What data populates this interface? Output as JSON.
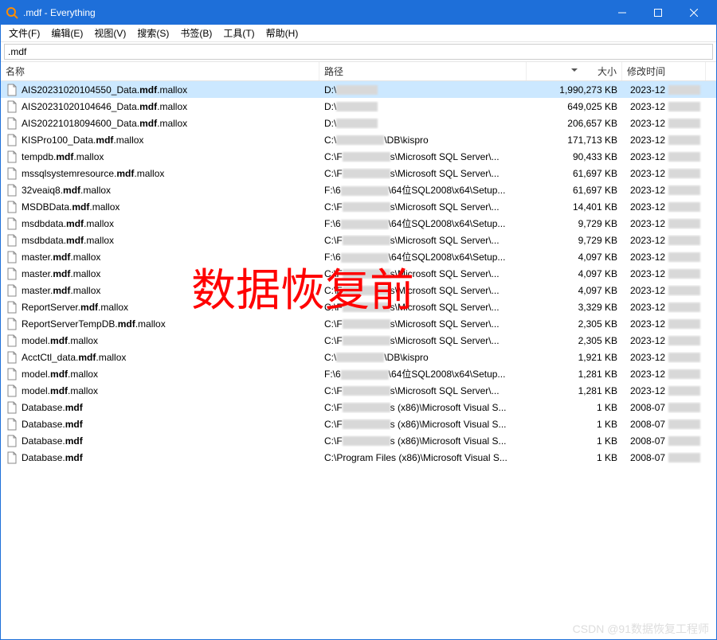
{
  "titlebar": {
    "title": ".mdf - Everything"
  },
  "menubar": {
    "file": "文件(F)",
    "edit": "编辑(E)",
    "view": "视图(V)",
    "search": "搜索(S)",
    "bookmarks": "书签(B)",
    "tools": "工具(T)",
    "help": "帮助(H)"
  },
  "search": {
    "value": ".mdf"
  },
  "columns": {
    "name": "名称",
    "path": "路径",
    "size": "大小",
    "date": "修改时间"
  },
  "overlay": "数据恢复前",
  "watermark": "CSDN @91数据恢复工程师",
  "rows": [
    {
      "selected": true,
      "name_pre": "AIS20231020104550_Data.",
      "name_bold": "mdf",
      "name_post": ".mallox",
      "path_pre": "D:\\",
      "path_censor_w": 52,
      "path_post": "",
      "size": "1,990,273 KB",
      "date": "2023-12",
      "date_censor_w": 40
    },
    {
      "name_pre": "AIS20231020104646_Data.",
      "name_bold": "mdf",
      "name_post": ".mallox",
      "path_pre": "D:\\",
      "path_censor_w": 52,
      "path_post": "",
      "size": "649,025 KB",
      "date": "2023-12",
      "date_censor_w": 40
    },
    {
      "name_pre": "AIS20221018094600_Data.",
      "name_bold": "mdf",
      "name_post": ".mallox",
      "path_pre": "D:\\",
      "path_censor_w": 52,
      "path_post": "",
      "size": "206,657 KB",
      "date": "2023-12",
      "date_censor_w": 40
    },
    {
      "name_pre": "KISPro100_Data.",
      "name_bold": "mdf",
      "name_post": ".mallox",
      "path_pre": "C:\\",
      "path_censor_w": 60,
      "path_post": "\\DB\\kispro",
      "size": "171,713 KB",
      "date": "2023-12",
      "date_censor_w": 40
    },
    {
      "name_pre": "tempdb.",
      "name_bold": "mdf",
      "name_post": ".mallox",
      "path_pre": "C:\\F",
      "path_censor_w": 60,
      "path_post": "s\\Microsoft SQL Server\\...",
      "size": "90,433 KB",
      "date": "2023-12",
      "date_censor_w": 40
    },
    {
      "name_pre": "mssqlsystemresource.",
      "name_bold": "mdf",
      "name_post": ".mallox",
      "path_pre": "C:\\F",
      "path_censor_w": 60,
      "path_post": "s\\Microsoft SQL Server\\...",
      "size": "61,697 KB",
      "date": "2023-12",
      "date_censor_w": 40
    },
    {
      "name_pre": "32veaiq8.",
      "name_bold": "mdf",
      "name_post": ".mallox",
      "path_pre": "F:\\6",
      "path_censor_w": 60,
      "path_post": "\\64位SQL2008\\x64\\Setup...",
      "size": "61,697 KB",
      "date": "2023-12",
      "date_censor_w": 40
    },
    {
      "name_pre": "MSDBData.",
      "name_bold": "mdf",
      "name_post": ".mallox",
      "path_pre": "C:\\F",
      "path_censor_w": 60,
      "path_post": "s\\Microsoft SQL Server\\...",
      "size": "14,401 KB",
      "date": "2023-12",
      "date_censor_w": 40
    },
    {
      "name_pre": "msdbdata.",
      "name_bold": "mdf",
      "name_post": ".mallox",
      "path_pre": "F:\\6",
      "path_censor_w": 60,
      "path_post": "\\64位SQL2008\\x64\\Setup...",
      "size": "9,729 KB",
      "date": "2023-12",
      "date_censor_w": 40
    },
    {
      "name_pre": "msdbdata.",
      "name_bold": "mdf",
      "name_post": ".mallox",
      "path_pre": "C:\\F",
      "path_censor_w": 60,
      "path_post": "s\\Microsoft SQL Server\\...",
      "size": "9,729 KB",
      "date": "2023-12",
      "date_censor_w": 40
    },
    {
      "name_pre": "master.",
      "name_bold": "mdf",
      "name_post": ".mallox",
      "path_pre": "F:\\6",
      "path_censor_w": 60,
      "path_post": "\\64位SQL2008\\x64\\Setup...",
      "size": "4,097 KB",
      "date": "2023-12",
      "date_censor_w": 40
    },
    {
      "name_pre": "master.",
      "name_bold": "mdf",
      "name_post": ".mallox",
      "path_pre": "C:\\F",
      "path_censor_w": 60,
      "path_post": "s\\Microsoft SQL Server\\...",
      "size": "4,097 KB",
      "date": "2023-12",
      "date_censor_w": 40
    },
    {
      "name_pre": "master.",
      "name_bold": "mdf",
      "name_post": ".mallox",
      "path_pre": "C:\\F",
      "path_censor_w": 60,
      "path_post": "s\\Microsoft SQL Server\\...",
      "size": "4,097 KB",
      "date": "2023-12",
      "date_censor_w": 40
    },
    {
      "name_pre": "ReportServer.",
      "name_bold": "mdf",
      "name_post": ".mallox",
      "path_pre": "C:\\F",
      "path_censor_w": 60,
      "path_post": "s\\Microsoft SQL Server\\...",
      "size": "3,329 KB",
      "date": "2023-12",
      "date_censor_w": 40
    },
    {
      "name_pre": "ReportServerTempDB.",
      "name_bold": "mdf",
      "name_post": ".mallox",
      "path_pre": "C:\\F",
      "path_censor_w": 60,
      "path_post": "s\\Microsoft SQL Server\\...",
      "size": "2,305 KB",
      "date": "2023-12",
      "date_censor_w": 40
    },
    {
      "name_pre": "model.",
      "name_bold": "mdf",
      "name_post": ".mallox",
      "path_pre": "C:\\F",
      "path_censor_w": 60,
      "path_post": "s\\Microsoft SQL Server\\...",
      "size": "2,305 KB",
      "date": "2023-12",
      "date_censor_w": 40
    },
    {
      "name_pre": "AcctCtl_data.",
      "name_bold": "mdf",
      "name_post": ".mallox",
      "path_pre": "C:\\",
      "path_censor_w": 60,
      "path_post": "\\DB\\kispro",
      "size": "1,921 KB",
      "date": "2023-12",
      "date_censor_w": 40
    },
    {
      "name_pre": "model.",
      "name_bold": "mdf",
      "name_post": ".mallox",
      "path_pre": "F:\\6",
      "path_censor_w": 60,
      "path_post": "\\64位SQL2008\\x64\\Setup...",
      "size": "1,281 KB",
      "date": "2023-12",
      "date_censor_w": 40
    },
    {
      "name_pre": "model.",
      "name_bold": "mdf",
      "name_post": ".mallox",
      "path_pre": "C:\\F",
      "path_censor_w": 60,
      "path_post": "s\\Microsoft SQL Server\\...",
      "size": "1,281 KB",
      "date": "2023-12",
      "date_censor_w": 40
    },
    {
      "name_pre": "Database.",
      "name_bold": "mdf",
      "name_post": "",
      "path_pre": "C:\\F",
      "path_censor_w": 60,
      "path_post": "s (x86)\\Microsoft Visual S...",
      "size": "1 KB",
      "date": "2008-07",
      "date_censor_w": 40
    },
    {
      "name_pre": "Database.",
      "name_bold": "mdf",
      "name_post": "",
      "path_pre": "C:\\F",
      "path_censor_w": 60,
      "path_post": "s (x86)\\Microsoft Visual S...",
      "size": "1 KB",
      "date": "2008-07",
      "date_censor_w": 40
    },
    {
      "name_pre": "Database.",
      "name_bold": "mdf",
      "name_post": "",
      "path_pre": "C:\\F",
      "path_censor_w": 60,
      "path_post": "s (x86)\\Microsoft Visual S...",
      "size": "1 KB",
      "date": "2008-07",
      "date_censor_w": 40
    },
    {
      "name_pre": "Database.",
      "name_bold": "mdf",
      "name_post": "",
      "path_pre": "C:\\Program Files (x86)\\Microsoft Visual S...",
      "path_censor_w": 0,
      "path_post": "",
      "size": "1 KB",
      "date": "2008-07",
      "date_censor_w": 40
    }
  ]
}
